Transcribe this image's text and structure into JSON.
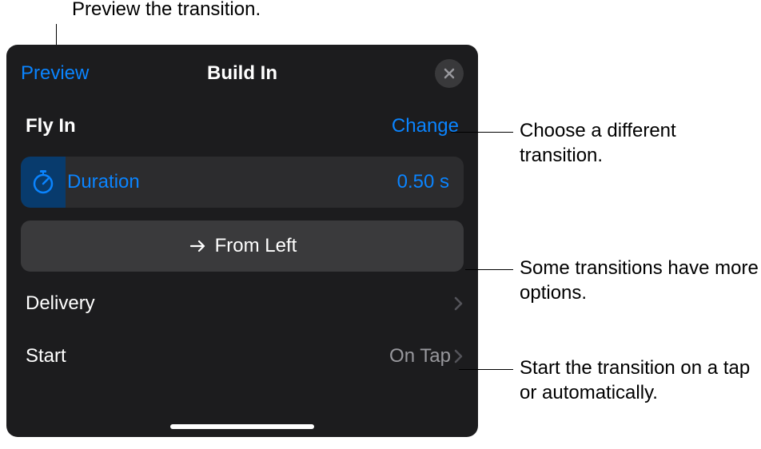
{
  "callouts": {
    "top": "Preview the transition.",
    "change": "Choose a different transition.",
    "direction": "Some transitions have more options.",
    "start": "Start the transition on a tap or automatically."
  },
  "header": {
    "preview_label": "Preview",
    "title": "Build In"
  },
  "transition": {
    "name": "Fly In",
    "change_label": "Change"
  },
  "duration": {
    "label": "Duration",
    "value": "0.50 s"
  },
  "direction": {
    "label": "From Left"
  },
  "rows": {
    "delivery_label": "Delivery",
    "start_label": "Start",
    "start_value": "On Tap"
  }
}
